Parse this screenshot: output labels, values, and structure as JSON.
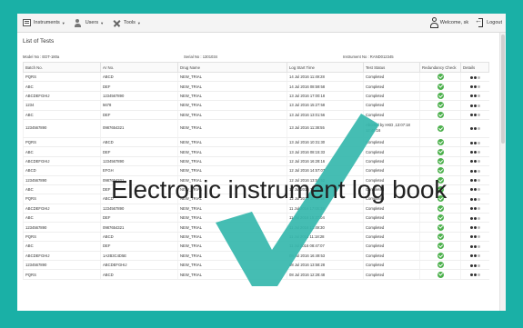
{
  "menu": {
    "instruments": "Instruments",
    "users": "Users",
    "tools": "Tools",
    "welcome": "Welcome, sk",
    "logout": "Logout"
  },
  "page_title": "List of Tests",
  "meta": {
    "model": "Model No : EDT-180a",
    "serial": "Serial No : 1301034",
    "instrument": "Instrument No : RAND012345"
  },
  "columns": [
    "Batch No.",
    "Ar No.",
    "Drug Name",
    "Log Start Time",
    "Test Status",
    "Redundancy Check",
    "Details"
  ],
  "rows": [
    {
      "batch": "PQRS",
      "ar": "ABCD",
      "drug": "NEW_TRIAL",
      "time": "14 Jul 2016 11:49:28",
      "status": "Completed"
    },
    {
      "batch": "ABC",
      "ar": "DEF",
      "drug": "NEW_TRIAL",
      "time": "14 Jul 2016 08:59:58",
      "status": "Completed"
    },
    {
      "batch": "ABCDEFGHIJ",
      "ar": "1234567890",
      "drug": "NEW_TRIAL",
      "time": "13 Jul 2016 17:00:18",
      "status": "Completed"
    },
    {
      "batch": "1234",
      "ar": "5678",
      "drug": "NEW_TRIAL",
      "time": "13 Jul 2016 15:27:58",
      "status": "Completed"
    },
    {
      "batch": "ABC",
      "ar": "DEF",
      "drug": "NEW_TRIAL",
      "time": "13 Jul 2016 13:01:56",
      "status": "Completed"
    },
    {
      "batch": "1234567890",
      "ar": "0987654321",
      "drug": "NEW_TRIAL",
      "time": "13 Jul 2016 11:38:55",
      "status": "Aborted by HKD ,13:07:18 12:40:16"
    },
    {
      "batch": "PQRS",
      "ar": "ABCD",
      "drug": "NEW_TRIAL",
      "time": "13 Jul 2016 10:31:30",
      "status": "Completed"
    },
    {
      "batch": "ABC",
      "ar": "DEF",
      "drug": "NEW_TRIAL",
      "time": "13 Jul 2016 08:15:33",
      "status": "Completed"
    },
    {
      "batch": "ABCDEFGHIJ",
      "ar": "1234567890",
      "drug": "NEW_TRIAL",
      "time": "12 Jul 2016 16:28:16",
      "status": "Completed"
    },
    {
      "batch": "ABCD",
      "ar": "EFGH",
      "drug": "NEW_TRIAL",
      "time": "12 Jul 2016 14:57:07",
      "status": "Completed"
    },
    {
      "batch": "1234567890",
      "ar": "0987654321",
      "drug": "NEW_TRIAL",
      "time": "12 Jul 2016 13:52:52",
      "status": "Completed"
    },
    {
      "batch": "ABC",
      "ar": "DEF",
      "drug": "NEW_TRIAL",
      "time": "12 Jul 2016 11:39:38",
      "status": "Completed"
    },
    {
      "batch": "PQRS",
      "ar": "ABCD",
      "drug": "NEW_TRIAL",
      "time": "12 Jul 2016 10:09:56",
      "status": "Completed"
    },
    {
      "batch": "ABCDEFGHIJ",
      "ar": "1234567890",
      "drug": "NEW_TRIAL",
      "time": "11 Jul 2016 17:05:38",
      "status": "Completed"
    },
    {
      "batch": "ABC",
      "ar": "DEF",
      "drug": "NEW_TRIAL",
      "time": "11 Jul 2016 15:27:04",
      "status": "Completed"
    },
    {
      "batch": "1234567890",
      "ar": "0987654321",
      "drug": "NEW_TRIAL",
      "time": "11 Jul 2016 13:49:30",
      "status": "Completed"
    },
    {
      "batch": "PQRS",
      "ar": "ABCD",
      "drug": "NEW_TRIAL",
      "time": "11 Jul 2016 11:18:28",
      "status": "Completed"
    },
    {
      "batch": "ABC",
      "ar": "DEF",
      "drug": "NEW_TRIAL",
      "time": "11 Jul 2016 08:47:07",
      "status": "Completed"
    },
    {
      "batch": "ABCDEFGHIJ",
      "ar": "1A2B3C4D5E",
      "drug": "NEW_TRIAL",
      "time": "08 Jul 2016 16:49:53",
      "status": "Completed"
    },
    {
      "batch": "1234567890",
      "ar": "ABCDEFGHIJ",
      "drug": "NEW_TRIAL",
      "time": "08 Jul 2016 13:58:28",
      "status": "Completed"
    },
    {
      "batch": "PQRS",
      "ar": "ABCD",
      "drug": "NEW_TRIAL",
      "time": "08 Jul 2016 12:28:48",
      "status": "Completed"
    }
  ],
  "overlay_text": "Electronic instrument log book",
  "colors": {
    "background": "#1ab0a6",
    "watermark_check": "#35b7ad",
    "redundancy_ok": "#4cb04c"
  },
  "icons": {
    "watermark": "checkmark-icon",
    "redundancy": "check-circle-icon",
    "details": "three-dots-icon"
  }
}
